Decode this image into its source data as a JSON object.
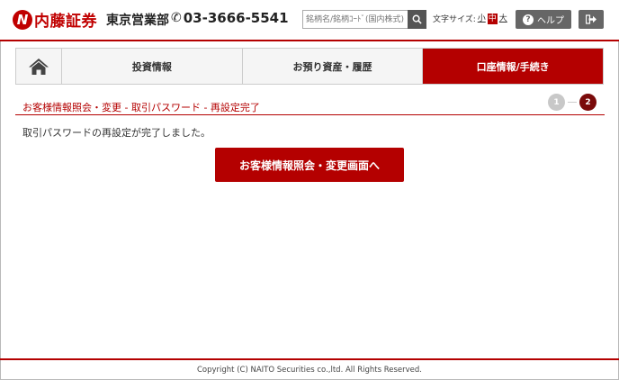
{
  "header": {
    "logo_text": "内藤証券",
    "logo_mark": "N",
    "branch": "東京営業部",
    "phone": "03-3666-5541",
    "search": {
      "placeholder": "銘柄名/銘柄ｺｰﾄﾞ(国内株式)"
    },
    "fontsize": {
      "label": "文字サイズ:",
      "small": "小",
      "medium": "中",
      "large": "大",
      "selected": "中"
    },
    "help_label": "ヘルプ"
  },
  "nav": {
    "tabs": [
      {
        "label": "投資情報"
      },
      {
        "label": "お預り資産・履歴"
      },
      {
        "label": "口座情報/手続き",
        "active": true
      }
    ]
  },
  "page": {
    "title": "お客様情報照会・変更 - 取引パスワード - 再設定完了",
    "steps": [
      "1",
      "2"
    ],
    "current_step": 2,
    "message": "取引パスワードの再設定が完了しました。",
    "cta_label": "お客様情報照会・変更画面へ"
  },
  "footer": {
    "copyright": "Copyright (C) NAITO Securities co.,ltd. All Rights Reserved."
  },
  "colors": {
    "brand": "#b40000",
    "step_current": "#7a0a0a",
    "step_done": "#c8c8c8",
    "button_gray": "#666666"
  },
  "icons": [
    "home-icon",
    "search-icon",
    "help-icon",
    "logout-icon",
    "phone-icon"
  ]
}
